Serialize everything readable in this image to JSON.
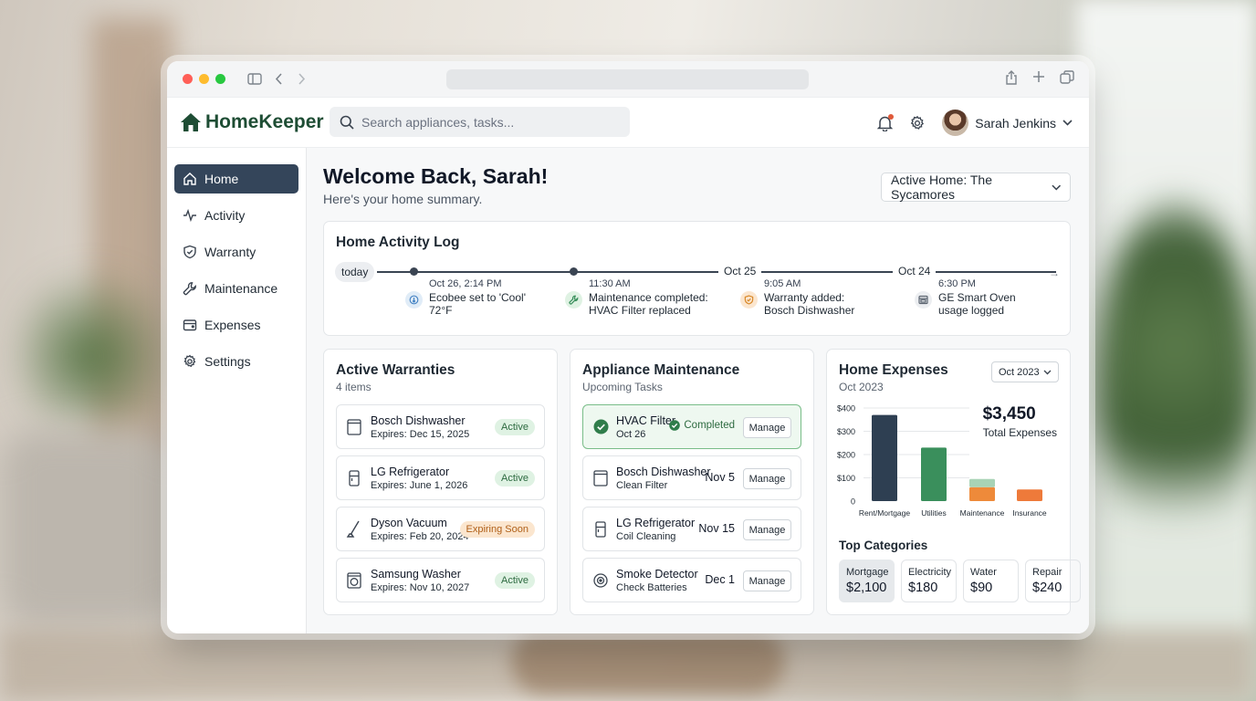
{
  "app": {
    "name": "HomeKeeper"
  },
  "search": {
    "placeholder": "Search appliances, tasks..."
  },
  "user": {
    "name": "Sarah Jenkins"
  },
  "sidebar": {
    "items": [
      {
        "label": "Home",
        "icon": "house-icon",
        "active": true
      },
      {
        "label": "Activity",
        "icon": "pulse-icon"
      },
      {
        "label": "Warranty",
        "icon": "shield-icon"
      },
      {
        "label": "Maintenance",
        "icon": "wrench-icon"
      },
      {
        "label": "Expenses",
        "icon": "wallet-icon"
      },
      {
        "label": "Settings",
        "icon": "gear-icon"
      }
    ]
  },
  "page": {
    "title": "Welcome Back, Sarah!",
    "subtitle": "Here's your home summary.",
    "home_select": "Active Home: The Sycamores"
  },
  "activity": {
    "title": "Home Activity Log",
    "today_label": "today",
    "dates": [
      "Oct 25",
      "Oct 24"
    ],
    "events": [
      {
        "time": "Oct 26, 2:14 PM",
        "line1": "Ecobee set to 'Cool'",
        "line2": "72°F",
        "icon": "thermostat-icon"
      },
      {
        "time": "11:30 AM",
        "line1": "Maintenance completed:",
        "line2": "HVAC Filter replaced",
        "icon": "wrench-icon"
      },
      {
        "time": "9:05 AM",
        "line1": "Warranty added:",
        "line2": "Bosch Dishwasher",
        "icon": "shield-icon"
      },
      {
        "time": "6:30 PM",
        "line1": "GE Smart Oven",
        "line2": "usage logged",
        "icon": "oven-icon"
      }
    ]
  },
  "warranties": {
    "title": "Active Warranties",
    "count": "4 items",
    "items": [
      {
        "name": "Bosch Dishwasher",
        "expires": "Expires: Dec 15, 2025",
        "status": "Active",
        "tone": "green",
        "icon": "dishwasher-icon"
      },
      {
        "name": "LG Refrigerator",
        "expires": "Expires: June 1, 2026",
        "status": "Active",
        "tone": "green",
        "icon": "fridge-icon"
      },
      {
        "name": "Dyson Vacuum",
        "expires": "Expires: Feb 20, 2024",
        "status": "Expiring Soon",
        "tone": "orange",
        "icon": "vacuum-icon"
      },
      {
        "name": "Samsung Washer",
        "expires": "Expires: Nov 10, 2027",
        "status": "Active",
        "tone": "green",
        "icon": "washer-icon"
      }
    ]
  },
  "maintenance": {
    "title": "Appliance Maintenance",
    "subtitle": "Upcoming Tasks",
    "manage_label": "Manage",
    "items": [
      {
        "name": "HVAC Filter",
        "task": "Oct 26",
        "status": "Completed",
        "done": true
      },
      {
        "name": "Bosch Dishwasher",
        "task": "Clean Filter",
        "date": "Nov 5",
        "icon": "dishwasher-icon"
      },
      {
        "name": "LG Refrigerator",
        "task": "Coil Cleaning",
        "date": "Nov 15",
        "icon": "fridge-icon"
      },
      {
        "name": "Smoke Detector",
        "task": "Check Batteries",
        "date": "Dec 1",
        "icon": "smoke-detector-icon"
      }
    ]
  },
  "expenses": {
    "title": "Home Expenses",
    "subtitle": "Oct 2023",
    "month_select": "Oct 2023",
    "total_value": "$3,450",
    "total_label": "Total Expenses",
    "top_categories_title": "Top Categories",
    "categories": [
      {
        "name": "Mortgage",
        "value": "$2,100",
        "selected": true
      },
      {
        "name": "Electricity",
        "value": "$180"
      },
      {
        "name": "Water",
        "value": "$90"
      },
      {
        "name": "Repair",
        "value": "$240"
      }
    ]
  },
  "chart_data": {
    "type": "bar",
    "categories": [
      "Rent/Mortgage",
      "Utilities",
      "Maintenance",
      "Insurance"
    ],
    "series_stacks": [
      [
        {
          "value": 370,
          "color": "#2e3f52"
        }
      ],
      [
        {
          "value": 230,
          "color": "#3a8f5c"
        }
      ],
      [
        {
          "value": 60,
          "color": "#ee8a3a"
        },
        {
          "value": 35,
          "color": "#a8d3b6"
        }
      ],
      [
        {
          "value": 50,
          "color": "#ee7a3a"
        }
      ]
    ],
    "y_ticks": [
      "$400",
      "$300",
      "$200",
      "$100",
      "0"
    ],
    "ylim": [
      0,
      400
    ],
    "grid": true
  },
  "colors": {
    "brand": "#1e4d34",
    "nav_active": "#34455a",
    "active_pill": "#dff2e3",
    "warning_pill": "#fbe6cf"
  }
}
